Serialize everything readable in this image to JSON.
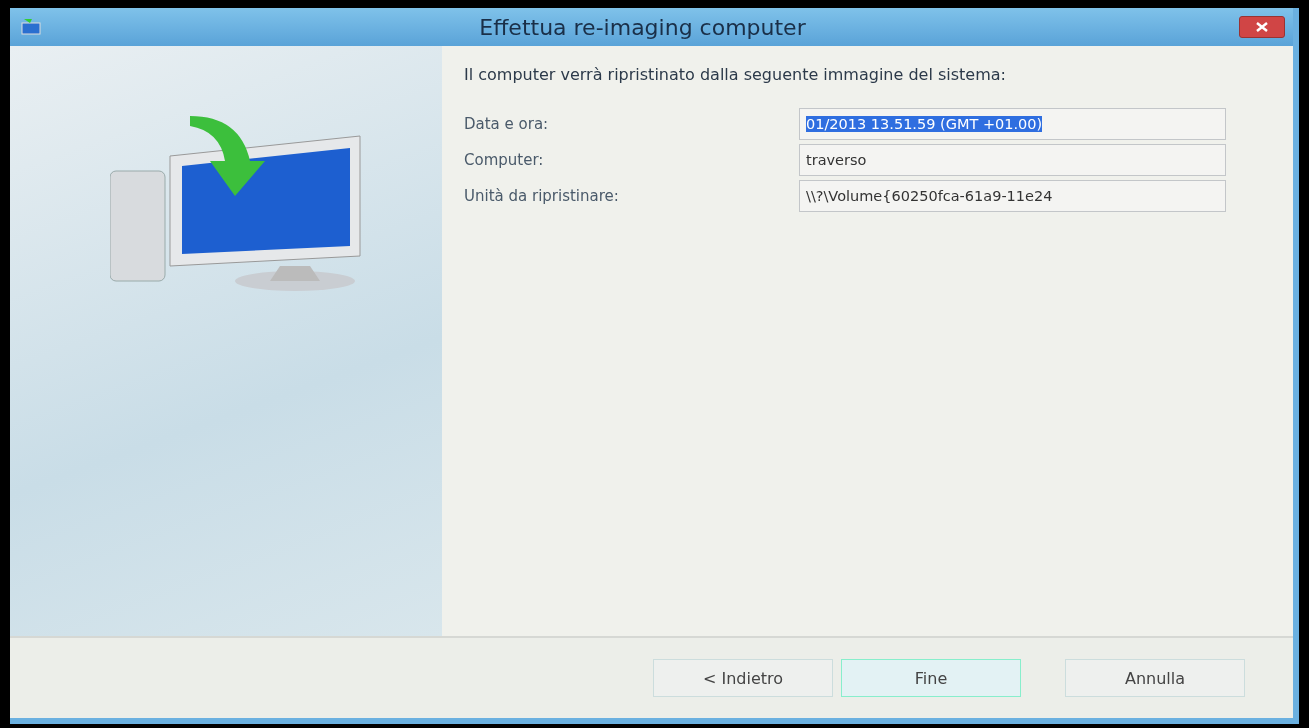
{
  "window": {
    "title": "Effettua re-imaging computer"
  },
  "intro": "Il computer verrà ripristinato dalla seguente immagine del sistema:",
  "fields": [
    {
      "label": "Data e ora:",
      "value": "01/2013 13.51.59 (GMT +01.00)",
      "selected": true
    },
    {
      "label": "Computer:",
      "value": "traverso",
      "selected": false
    },
    {
      "label": "Unità da ripristinare:",
      "value": "\\\\?\\Volume{60250fca-61a9-11e24",
      "selected": false
    }
  ],
  "buttons": [
    {
      "label": "< Indietro",
      "selected": false
    },
    {
      "label": "Fine",
      "selected": true
    },
    {
      "label": "Annulla",
      "selected": false
    }
  ]
}
